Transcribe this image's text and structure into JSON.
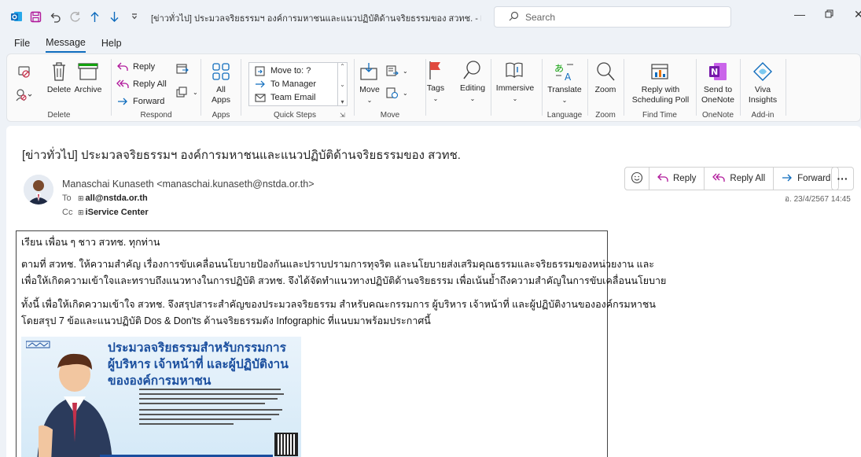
{
  "window": {
    "title": "[ข่าวทั่วไป] ประมวลจริยธรรมฯ องค์การมหาชนและแนวปฏิบัติด้านจริยธรรมของ สวทช.  -  Message (H...",
    "search_placeholder": "Search"
  },
  "menu": {
    "tabs": [
      "File",
      "Message",
      "Help"
    ],
    "active": "Message"
  },
  "ribbon": {
    "delete_group": {
      "delete": "Delete",
      "archive": "Archive",
      "label": "Delete"
    },
    "respond_group": {
      "reply": "Reply",
      "reply_all": "Reply All",
      "forward": "Forward",
      "label": "Respond"
    },
    "apps_group": {
      "all_apps_line1": "All",
      "all_apps_line2": "Apps",
      "label": "Apps"
    },
    "quick_steps_group": {
      "items": [
        "Move to: ?",
        "To Manager",
        "Team Email"
      ],
      "label": "Quick Steps"
    },
    "move_group": {
      "move": "Move",
      "label": "Move"
    },
    "tags": "Tags",
    "editing": "Editing",
    "immersive": "Immersive",
    "language_group": {
      "translate": "Translate",
      "label": "Language"
    },
    "zoom_group": {
      "zoom": "Zoom",
      "label": "Zoom"
    },
    "find_time_group": {
      "line1": "Reply with",
      "line2": "Scheduling Poll",
      "label": "Find Time"
    },
    "onenote_group": {
      "line1": "Send to",
      "line2": "OneNote",
      "label": "OneNote"
    },
    "addin_group": {
      "line1": "Viva",
      "line2": "Insights",
      "label": "Add-in"
    }
  },
  "message": {
    "subject": "[ข่าวทั่วไป] ประมวลจริยธรรมฯ องค์การมหาชนและแนวปฏิบัติด้านจริยธรรมของ สวทช.",
    "sender": "Manaschai Kunaseth <manaschai.kunaseth@nstda.or.th>",
    "to_label": "To",
    "to_value": "all@nstda.or.th",
    "cc_label": "Cc",
    "cc_value": "iService Center",
    "date": "อ. 23/4/2567 14:45",
    "actions": {
      "reply": "Reply",
      "reply_all": "Reply All",
      "forward": "Forward",
      "more": "···"
    },
    "body": {
      "greeting": "เรียน เพื่อน ๆ ชาว สวทช. ทุกท่าน",
      "para1_line1": "ตามที่ สวทช. ให้ความสำคัญ เรื่องการขับเคลื่อนนโยบายป้องกันและปราบปรามการทุจริต และนโยบายส่งเสริมคุณธรรมและจริยธรรมของหน่วยงาน และ",
      "para1_line2": "เพื่อให้เกิดความเข้าใจและทราบถึงแนวทางในการปฏิบัติ สวทช. จึงได้จัดทำแนวทางปฏิบัติด้านจริยธรรม เพื่อเน้นย้ำถึงความสำคัญในการขับเคลื่อนนโยบาย",
      "para2_line1": "ทั้งนี้ เพื่อให้เกิดความเข้าใจ สวทช. จึงสรุปสาระสำคัญของประมวลจริยธรรม สำหรับคณะกรรมการ ผู้บริหาร เจ้าหน้าที่ และผู้ปฏิบัติงานขององค์กรมหาชน",
      "para2_line2": "โดยสรุป 7 ข้อและแนวปฏิบัติ Dos & Don'ts ด้านจริยธรรมดัง Infographic ที่แนบมาพร้อมประกาศนี้"
    },
    "infographic": {
      "title": "ประมวลจริยธรรมสำหรับกรรมการ ผู้บริหาร เจ้าหน้าที่ และผู้ปฏิบัติงาน ขององค์การมหาชน"
    }
  }
}
